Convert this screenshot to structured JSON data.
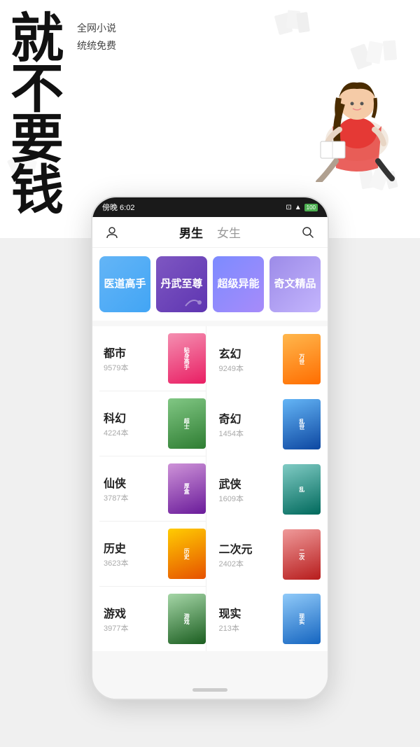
{
  "hero": {
    "big_text": "就不要钱",
    "small_text_line1": "全网小说",
    "small_text_line2": "统统免费"
  },
  "status_bar": {
    "time": "傍晚 6:02",
    "battery": "100"
  },
  "nav": {
    "tab_male": "男生",
    "tab_female": "女生",
    "active": "male"
  },
  "banners": [
    {
      "label": "医道高手",
      "class": "c1"
    },
    {
      "label": "丹武至尊",
      "class": "c2"
    },
    {
      "label": "超级异能",
      "class": "c3"
    },
    {
      "label": "奇文精品",
      "class": "c4"
    }
  ],
  "genres": [
    {
      "name": "都市",
      "count": "9579本",
      "book_class": "book-1",
      "book_text": "贴身高手"
    },
    {
      "name": "玄幻",
      "count": "9249本",
      "book_class": "book-2",
      "book_text": "万世"
    },
    {
      "name": "科幻",
      "count": "4224本",
      "book_class": "book-3",
      "book_text": "超士强者"
    },
    {
      "name": "奇幻",
      "count": "1454本",
      "book_class": "book-4",
      "book_text": "乱世归"
    },
    {
      "name": "仙侠",
      "count": "3787本",
      "book_class": "book-5",
      "book_text": "厚盒"
    },
    {
      "name": "武侠",
      "count": "1609本",
      "book_class": "book-6",
      "book_text": "乱"
    },
    {
      "name": "历史",
      "count": "3623本",
      "book_class": "book-7",
      "book_text": "历史"
    },
    {
      "name": "二次元",
      "count": "2402本",
      "book_class": "book-8",
      "book_text": "二次元"
    },
    {
      "name": "游戏",
      "count": "3977本",
      "book_class": "book-9",
      "book_text": "游戏"
    },
    {
      "name": "现实",
      "count": "213本",
      "book_class": "book-10",
      "book_text": "现实"
    }
  ]
}
